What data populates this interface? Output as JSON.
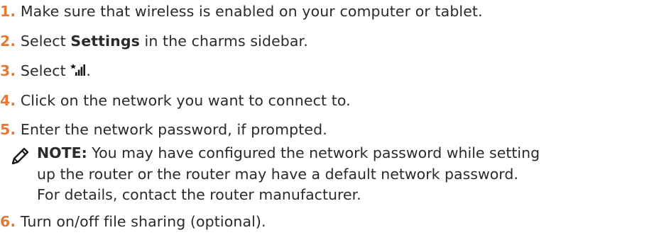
{
  "steps": [
    {
      "num": "1.",
      "text": "Make sure that wireless is enabled on your computer or tablet."
    },
    {
      "num": "2.",
      "before": "Select ",
      "bold": "Settings",
      "after": " in the charms sidebar."
    },
    {
      "num": "3.",
      "before": "Select ",
      "icon": "wireless-signal-icon",
      "after": "."
    },
    {
      "num": "4.",
      "text": "Click on the network you want to connect to."
    },
    {
      "num": "5.",
      "text": "Enter the network password, if prompted."
    },
    {
      "num": "6.",
      "text": "Turn on/off file sharing (optional)."
    }
  ],
  "note": {
    "icon": "note-pencil-icon",
    "label": "NOTE:",
    "line1": " You may have configured the network password while setting",
    "line2": "up the router or the router may have a default network password.",
    "line3": "For details, contact the router manufacturer."
  },
  "colors": {
    "step_number": "#e07b39",
    "text": "#2a2a2a",
    "icon": "#1a1a1a"
  }
}
